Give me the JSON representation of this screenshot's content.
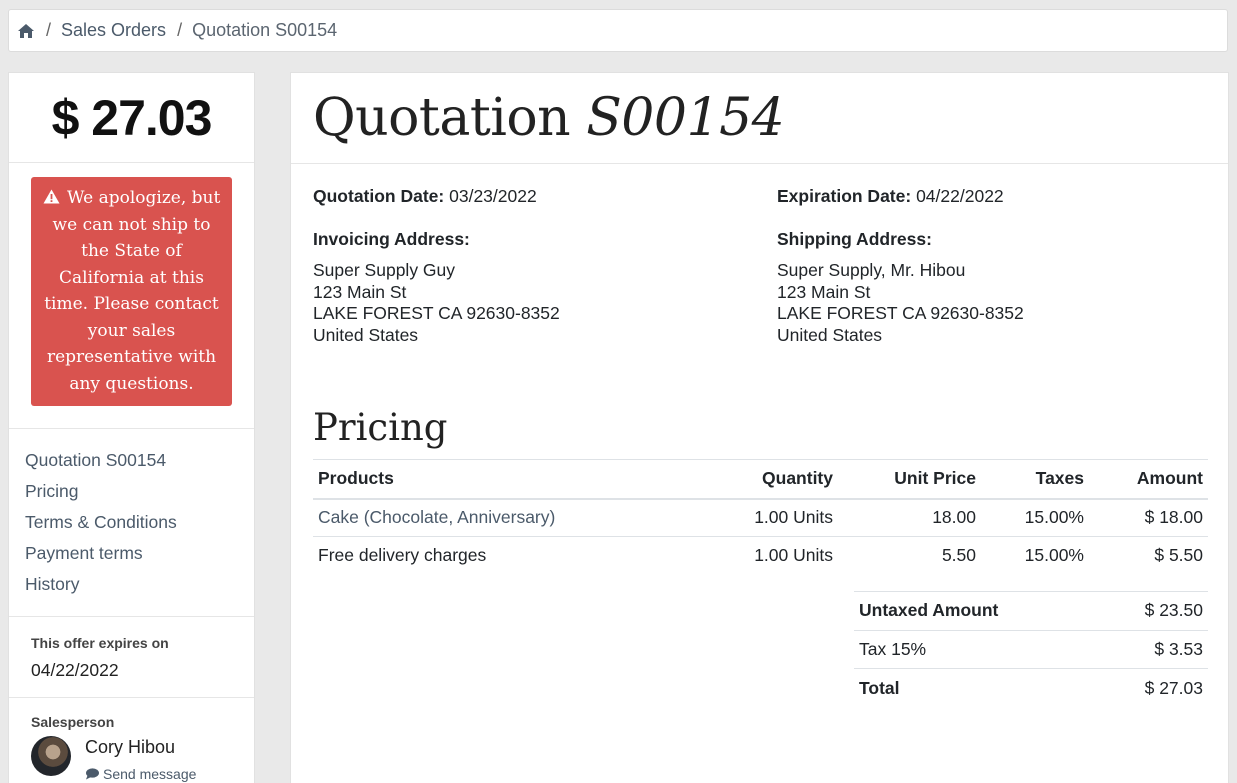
{
  "breadcrumb": {
    "home_icon": "home-icon",
    "items": [
      {
        "label": "Sales Orders"
      },
      {
        "label": "Quotation S00154"
      }
    ]
  },
  "sidebar": {
    "total": "$ 27.03",
    "alert": {
      "icon": "warning-triangle-icon",
      "text": "We apologize, but we can not ship to the State of California at this time. Please contact your sales representative with any questions."
    },
    "nav": [
      {
        "label": "Quotation S00154"
      },
      {
        "label": "Pricing"
      },
      {
        "label": "Terms & Conditions"
      },
      {
        "label": "Payment terms"
      },
      {
        "label": "History"
      }
    ],
    "expires_label": "This offer expires on",
    "expires_date": "04/22/2022",
    "salesperson_label": "Salesperson",
    "salesperson_name": "Cory Hibou",
    "send_message": "Send message"
  },
  "main": {
    "title_prefix": "Quotation",
    "title_number": "S00154",
    "quotation_date_label": "Quotation Date:",
    "quotation_date": "03/23/2022",
    "expiration_date_label": "Expiration Date:",
    "expiration_date": "04/22/2022",
    "invoicing": {
      "label": "Invoicing Address:",
      "lines": [
        "Super Supply Guy",
        "123 Main St",
        "LAKE FOREST CA 92630-8352",
        "United States"
      ]
    },
    "shipping": {
      "label": "Shipping Address:",
      "lines": [
        "Super Supply, Mr. Hibou",
        "123 Main St",
        "LAKE FOREST CA 92630-8352",
        "United States"
      ]
    },
    "pricing_title": "Pricing",
    "columns": [
      "Products",
      "Quantity",
      "Unit Price",
      "Taxes",
      "Amount"
    ],
    "lines": [
      {
        "product": "Cake (Chocolate, Anniversary)",
        "link": true,
        "quantity": "1.00 Units",
        "unit_price": "18.00",
        "taxes": "15.00%",
        "amount": "$ 18.00"
      },
      {
        "product": "Free delivery charges",
        "link": false,
        "quantity": "1.00 Units",
        "unit_price": "5.50",
        "taxes": "15.00%",
        "amount": "$ 5.50"
      }
    ],
    "totals": [
      {
        "label": "Untaxed Amount",
        "value": "$ 23.50",
        "bold": true
      },
      {
        "label": "Tax 15%",
        "value": "$ 3.53",
        "bold": false
      },
      {
        "label": "Total",
        "value": "$ 27.03",
        "bold": true
      }
    ]
  }
}
